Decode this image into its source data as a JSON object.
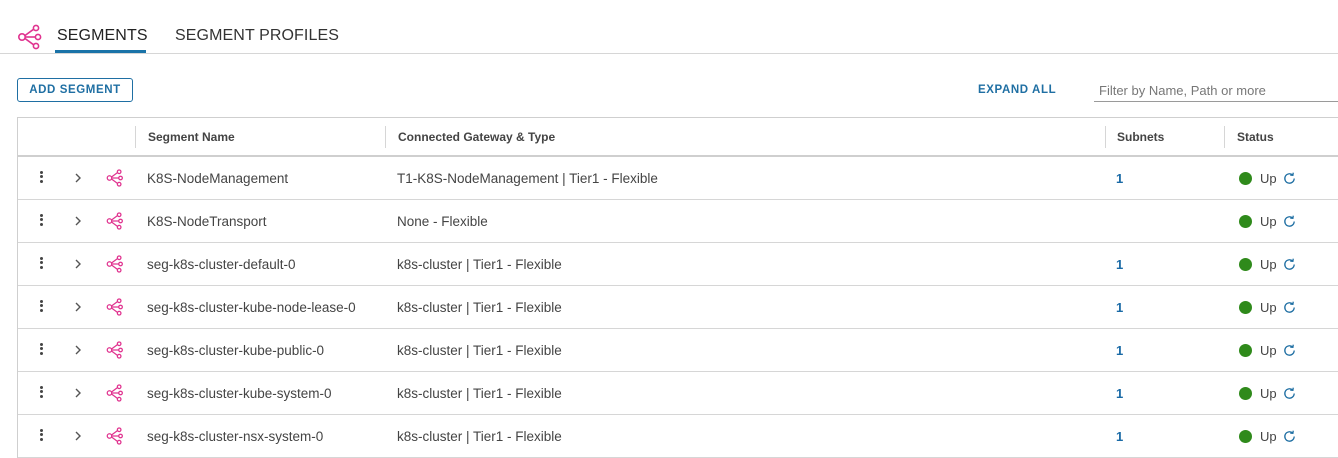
{
  "tabs": [
    {
      "label": "SEGMENTS",
      "active": true
    },
    {
      "label": "SEGMENT PROFILES",
      "active": false
    }
  ],
  "toolbar": {
    "add_label": "ADD SEGMENT",
    "expand_label": "EXPAND ALL",
    "filter_placeholder": "Filter by Name, Path or more"
  },
  "columns": {
    "name": "Segment Name",
    "gateway": "Connected Gateway & Type",
    "subnets": "Subnets",
    "status": "Status"
  },
  "rows": [
    {
      "name": "K8S-NodeManagement",
      "gateway": "T1-K8S-NodeManagement | Tier1 - Flexible",
      "subnets": "1",
      "status": "Up"
    },
    {
      "name": "K8S-NodeTransport",
      "gateway": "None - Flexible",
      "subnets": "",
      "status": "Up"
    },
    {
      "name": "seg-k8s-cluster-default-0",
      "gateway": "k8s-cluster | Tier1 - Flexible",
      "subnets": "1",
      "status": "Up"
    },
    {
      "name": "seg-k8s-cluster-kube-node-lease-0",
      "gateway": "k8s-cluster | Tier1 - Flexible",
      "subnets": "1",
      "status": "Up"
    },
    {
      "name": "seg-k8s-cluster-kube-public-0",
      "gateway": "k8s-cluster | Tier1 - Flexible",
      "subnets": "1",
      "status": "Up"
    },
    {
      "name": "seg-k8s-cluster-kube-system-0",
      "gateway": "k8s-cluster | Tier1 - Flexible",
      "subnets": "1",
      "status": "Up"
    },
    {
      "name": "seg-k8s-cluster-nsx-system-0",
      "gateway": "k8s-cluster | Tier1 - Flexible",
      "subnets": "1",
      "status": "Up"
    }
  ],
  "icons": {
    "segment": "segment-network-icon",
    "actions": "kebab-menu-icon",
    "expand": "chevron-right-icon",
    "refresh": "refresh-icon"
  },
  "colors": {
    "accent": "#1f6fa3",
    "segment_icon": "#e0338f",
    "status_up": "#2f8a1b"
  }
}
